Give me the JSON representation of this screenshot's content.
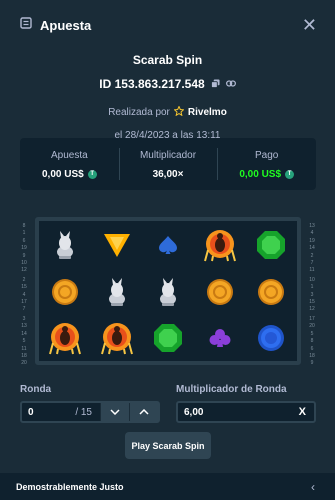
{
  "header": {
    "title": "Apuesta",
    "icon": "receipt-icon"
  },
  "game": {
    "name": "Scarab Spin",
    "bet_id": "ID 153.863.217.548",
    "placed_by_prefix": "Realizada por",
    "user": "Rivelmo",
    "date": "el 28/4/2023 a las 13:11"
  },
  "stats": [
    {
      "label": "Apuesta",
      "value": "0,00 US$"
    },
    {
      "label": "Multiplicador",
      "value": "36,00×"
    },
    {
      "label": "Pago",
      "value": "0,00 US$"
    }
  ],
  "board": {
    "left_lines": [
      "8",
      "1",
      "6",
      "19",
      "9",
      "10",
      "12",
      "2",
      "15",
      "4",
      "17",
      "7",
      "3",
      "13",
      "14",
      "5",
      "11",
      "18",
      "20"
    ],
    "right_lines": [
      "13",
      "4",
      "19",
      "14",
      "2",
      "7",
      "11",
      "10",
      "1",
      "3",
      "15",
      "12",
      "17",
      "20",
      "5",
      "8",
      "6",
      "18",
      "9"
    ],
    "symbols": [
      [
        "statue",
        "triangle",
        "spade",
        "scarab",
        "emerald"
      ],
      [
        "coin",
        "statue",
        "statue",
        "coin",
        "coin"
      ],
      [
        "scarab",
        "scarab",
        "emerald",
        "club",
        "circle"
      ]
    ]
  },
  "form": {
    "round_label": "Ronda",
    "round_value": "0",
    "round_total": "/ 15",
    "round_mult_label": "Multiplicador de Ronda",
    "round_mult_value": "6,00",
    "clear_label": "X"
  },
  "play_label": "Play Scarab Spin",
  "footer_label": "Demostrablemente Justo",
  "colors": {
    "bg": "#1a2c38",
    "panel": "#0f212e",
    "green": "#1fff20"
  }
}
